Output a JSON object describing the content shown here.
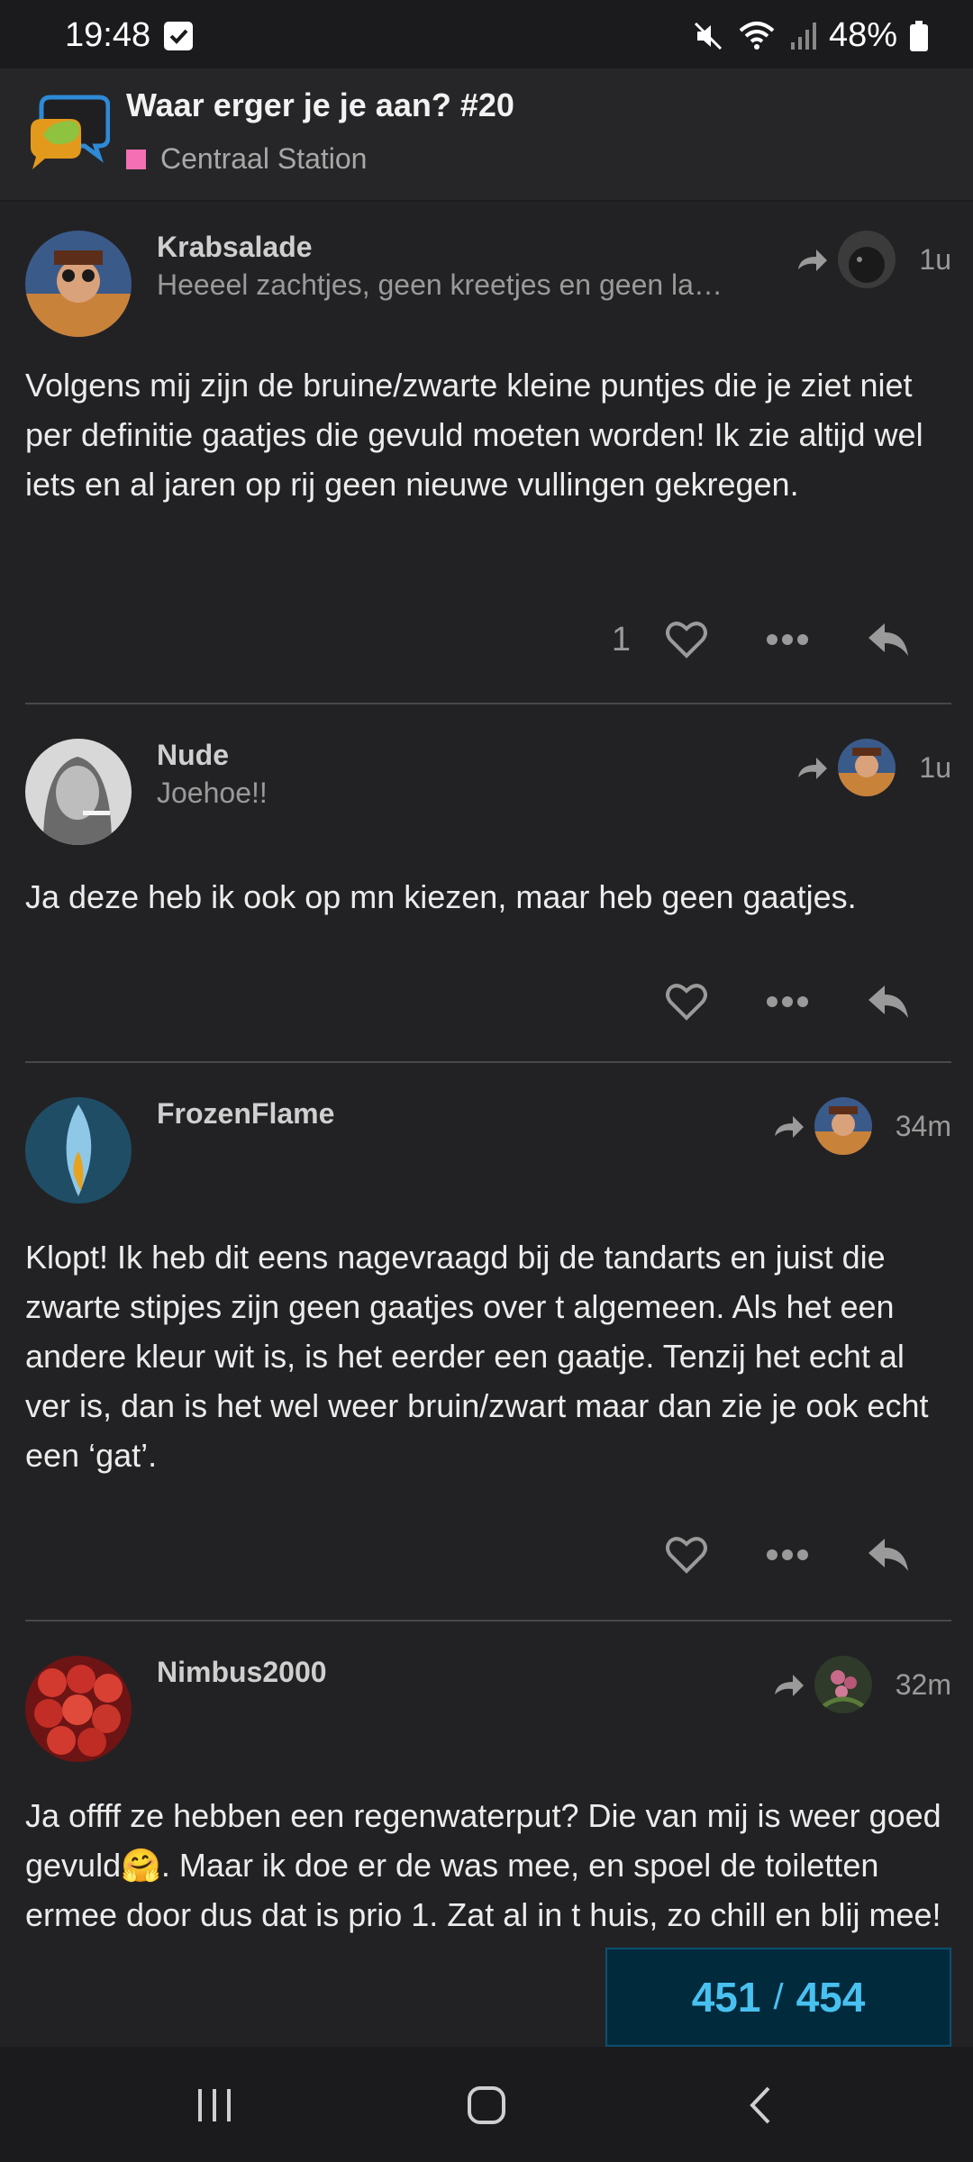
{
  "status_bar": {
    "time": "19:48",
    "battery": "48%"
  },
  "topic": {
    "title": "Waar erger je je aan? #20",
    "category": "Centraal Station",
    "category_color": "#f46fb4"
  },
  "posts": [
    {
      "username": "Krabsalade",
      "user_title": "Heeeel zachtjes, geen kreetjes en geen lachj...",
      "time": "1u",
      "body": "Volgens mij zijn de bruine/zwarte kleine puntjes die je ziet niet per definitie gaatjes die gevuld moeten worden! Ik zie altijd wel iets en al jaren op rij geen nieuwe vullingen gekregen.",
      "likes": "1"
    },
    {
      "username": "Nude",
      "user_title": "Joehoe!!",
      "time": "1u",
      "body": "Ja deze heb ik ook op mn kiezen, maar heb geen gaatjes."
    },
    {
      "username": "FrozenFlame",
      "user_title": "",
      "time": "34m",
      "body": "Klopt! Ik heb dit eens nagevraagd bij de tandarts en juist die zwarte stipjes zijn geen gaatjes over t algemeen. Als het een andere kleur wit is, is het eerder een gaatje. Tenzij het echt al ver is, dan is het wel weer bruin/zwart maar dan zie je ook echt een ‘gat’."
    },
    {
      "username": "Nimbus2000",
      "user_title": "",
      "time": "32m",
      "body": "Ja offff ze hebben een regenwaterput? Die van mij is weer goed gevuld🤗. Maar ik doe er de was mee, en spoel de toiletten ermee door dus dat is prio 1. Zat al in t huis, zo chill en blij mee!"
    }
  ],
  "progress": {
    "current": "451",
    "separator": "/",
    "total": "454"
  },
  "icons": [
    "check-icon",
    "mute-icon",
    "wifi-icon",
    "signal-icon",
    "battery-icon",
    "reply-arrow-icon",
    "heart-icon",
    "more-icon",
    "reply-icon",
    "recent-apps-icon",
    "home-icon",
    "back-icon"
  ]
}
